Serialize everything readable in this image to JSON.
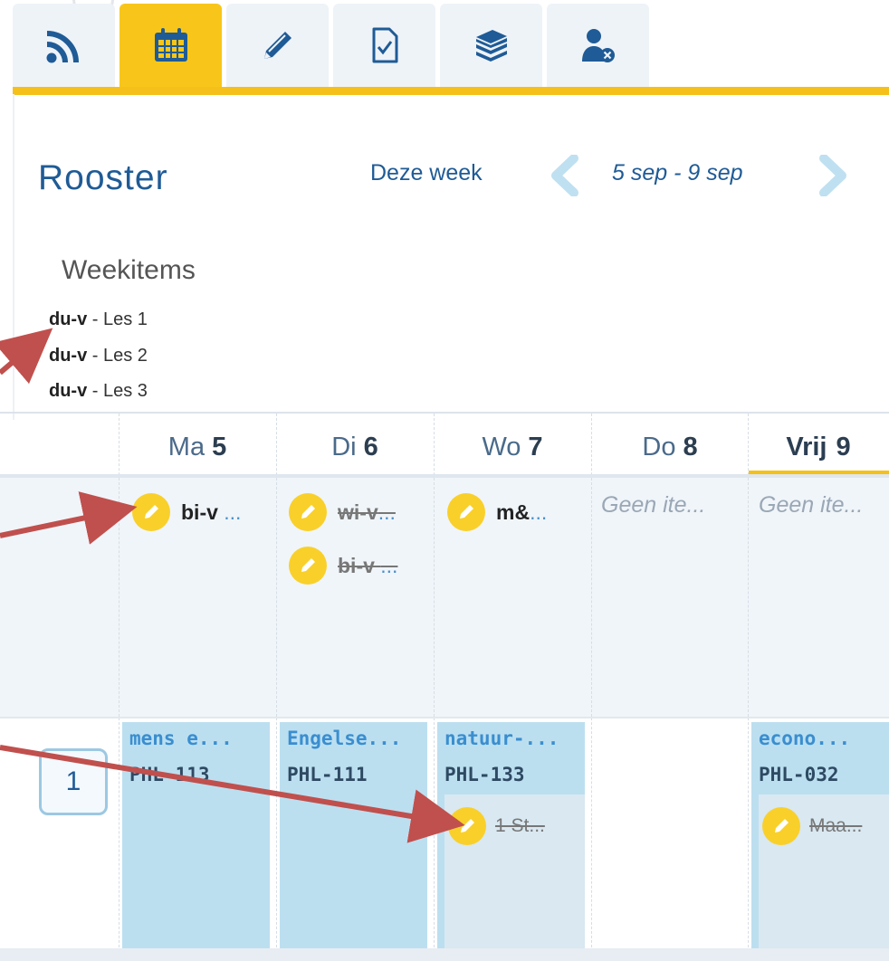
{
  "tabs": [
    {
      "icon": "rss-feed-icon",
      "active": false
    },
    {
      "icon": "calendar-icon",
      "active": true
    },
    {
      "icon": "pencil-icon",
      "active": false
    },
    {
      "icon": "checklist-document-icon",
      "active": false
    },
    {
      "icon": "books-icon",
      "active": false
    },
    {
      "icon": "user-remove-icon",
      "active": false
    }
  ],
  "header": {
    "title": "Rooster",
    "week_label": "Deze week",
    "week_range": "5 sep - 9 sep"
  },
  "weekitems": {
    "title": "Weekitems",
    "items": [
      {
        "code": "du-v",
        "sep": " - ",
        "text": "Les 1"
      },
      {
        "code": "du-v",
        "sep": " - ",
        "text": "Les 2"
      },
      {
        "code": "du-v",
        "sep": " - ",
        "text": "Les 3"
      }
    ]
  },
  "days": [
    {
      "name": "Ma",
      "num": "5"
    },
    {
      "name": "Di",
      "num": "6"
    },
    {
      "name": "Wo",
      "num": "7"
    },
    {
      "name": "Do",
      "num": "8"
    },
    {
      "name": "Vrij",
      "num": "9"
    }
  ],
  "allday": {
    "ma": [
      {
        "text": "bi-v",
        "ellipsis": " ...",
        "done": false
      }
    ],
    "di": [
      {
        "text": "wi-v",
        "ellipsis": "...",
        "done": true
      },
      {
        "text": "bi-v ",
        "ellipsis": "...",
        "done": true
      }
    ],
    "wo": [
      {
        "text": "m&",
        "ellipsis": "...",
        "done": false
      }
    ],
    "do_empty": "Geen ite...",
    "vrij_empty": "Geen ite..."
  },
  "hour1": {
    "label": "1",
    "lessons": [
      {
        "subject": "mens e...",
        "room": "PHL-113"
      },
      {
        "subject": "Engelse...",
        "room": "PHL-111"
      },
      {
        "subject": "natuur-...",
        "room": "PHL-133",
        "task": "1 St..."
      },
      {
        "subject": "econo...",
        "room": "PHL-032",
        "task": "Maa..."
      }
    ]
  },
  "colors": {
    "accent_yellow": "#f6c01b",
    "title_blue": "#1f5b96",
    "lesson_blue": "#bcdff0",
    "arrow_red": "#c0504d"
  }
}
